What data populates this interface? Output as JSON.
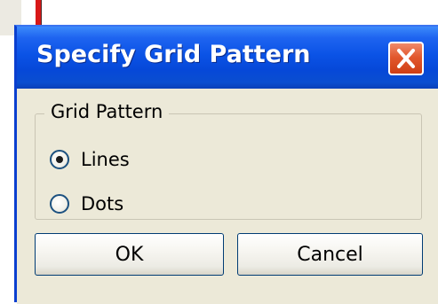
{
  "dialog": {
    "title": "Specify Grid Pattern",
    "close_icon": "close-x-icon",
    "group_label": "Grid Pattern",
    "options": [
      {
        "label": "Lines",
        "selected": true
      },
      {
        "label": "Dots",
        "selected": false
      }
    ],
    "ok_label": "OK",
    "cancel_label": "Cancel"
  },
  "colors": {
    "titlebar": "#0b53e6",
    "close_button": "#e2582e",
    "dialog_face": "#ece9d8",
    "background_red_bar": "#d81818"
  }
}
